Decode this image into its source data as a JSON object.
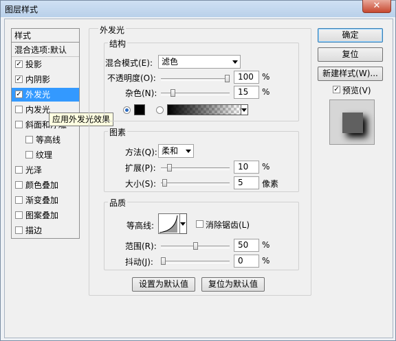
{
  "window": {
    "title": "图层样式",
    "close": "✕"
  },
  "left_panel": {
    "header": "样式",
    "blend_options": "混合选项:默认",
    "items": [
      {
        "label": "投影",
        "checked": true
      },
      {
        "label": "内阴影",
        "checked": true
      },
      {
        "label": "外发光",
        "checked": true,
        "selected": true
      },
      {
        "label": "内发光",
        "checked": false
      },
      {
        "label": "斜面和浮雕",
        "checked": false
      },
      {
        "label": "等高线",
        "checked": false,
        "sub": true
      },
      {
        "label": "纹理",
        "checked": false,
        "sub": true
      },
      {
        "label": "光泽",
        "checked": false
      },
      {
        "label": "颜色叠加",
        "checked": false
      },
      {
        "label": "渐变叠加",
        "checked": false
      },
      {
        "label": "图案叠加",
        "checked": false
      },
      {
        "label": "描边",
        "checked": false
      }
    ],
    "tooltip": "应用外发光效果"
  },
  "outer_glow": {
    "title": "外发光",
    "structure": {
      "title": "结构",
      "blend_mode_label": "混合模式(E):",
      "blend_mode_value": "滤色",
      "opacity_label": "不透明度(O):",
      "opacity_value": "100",
      "opacity_unit": "%",
      "opacity_level": 1.0,
      "noise_label": "杂色(N):",
      "noise_value": "15",
      "noise_unit": "%",
      "noise_level": 0.15,
      "color": "#000000"
    },
    "elements": {
      "title": "图素",
      "method_label": "方法(Q):",
      "method_value": "柔和",
      "spread_label": "扩展(P):",
      "spread_value": "10",
      "spread_unit": "%",
      "spread_level": 0.1,
      "size_label": "大小(S):",
      "size_value": "5",
      "size_unit": "像素",
      "size_level": 0.02
    },
    "quality": {
      "title": "品质",
      "contour_label": "等高线:",
      "anti_alias_label": "消除锯齿(L)",
      "anti_alias_checked": false,
      "range_label": "范围(R):",
      "range_value": "50",
      "range_unit": "%",
      "range_level": 0.5,
      "jitter_label": "抖动(J):",
      "jitter_value": "0",
      "jitter_unit": "%",
      "jitter_level": 0.0
    },
    "make_default": "设置为默认值",
    "reset_default": "复位为默认值"
  },
  "buttons": {
    "ok": "确定",
    "reset": "复位",
    "new_style": "新建样式(W)...",
    "preview_label": "预览(V)",
    "preview_checked": true
  }
}
